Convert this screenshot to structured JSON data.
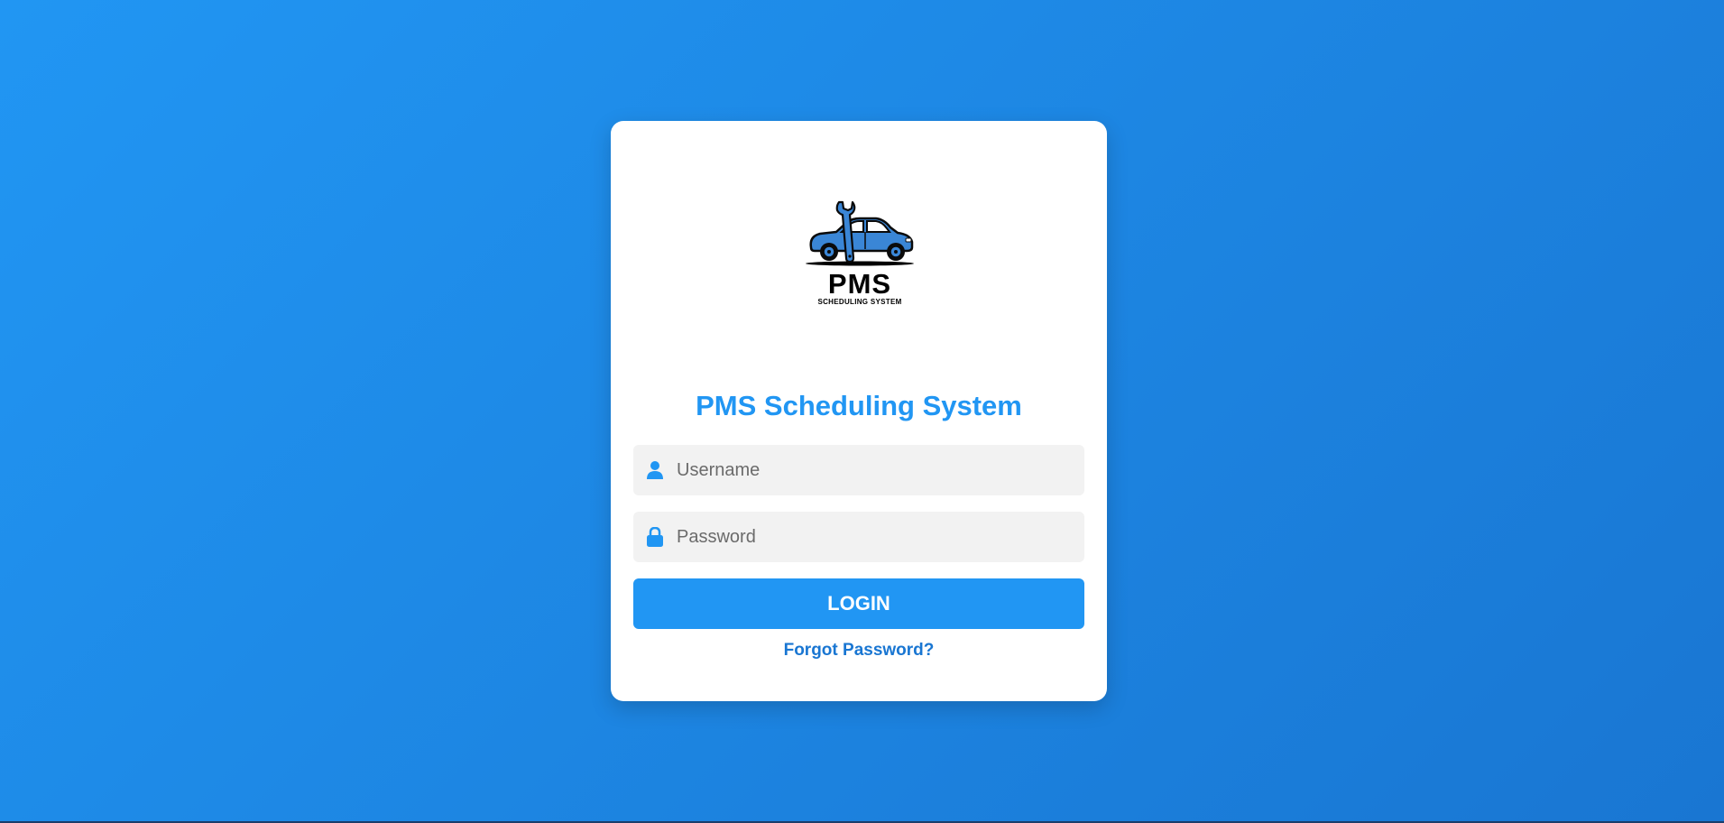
{
  "brand": {
    "logo_main": "PMS",
    "logo_sub": "SCHEDULING SYSTEM",
    "accent_color": "#2196f3",
    "logo_icon": "car-wrench-icon"
  },
  "login": {
    "title": "PMS Scheduling System",
    "username_placeholder": "Username",
    "username_value": "",
    "username_icon": "user-icon",
    "password_placeholder": "Password",
    "password_value": "",
    "password_icon": "lock-icon",
    "submit_label": "LOGIN",
    "forgot_label": "Forgot Password?"
  },
  "colors": {
    "background_start": "#2196f3",
    "background_end": "#1976d2",
    "card": "#ffffff",
    "field_bg": "#f2f2f2",
    "link": "#1976d2"
  }
}
